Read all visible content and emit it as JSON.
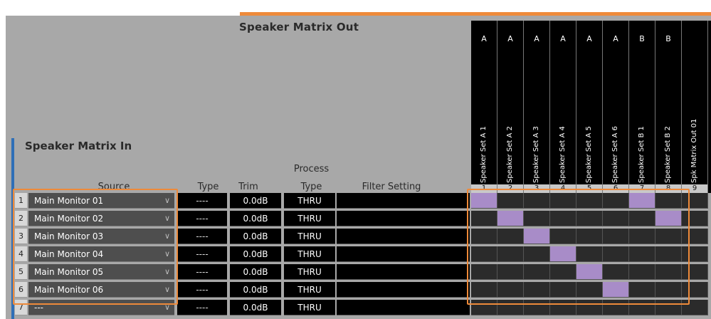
{
  "titles": {
    "matrix_out": "Speaker Matrix Out",
    "matrix_in": "Speaker Matrix In"
  },
  "headers": {
    "source": "Source",
    "type": "Type",
    "trim": "Trim",
    "process_line1": "Process",
    "process_line2": "Type",
    "filter": "Filter Setting"
  },
  "outputs": [
    {
      "group": "A",
      "name": "Speaker Set A 1",
      "num": "1"
    },
    {
      "group": "A",
      "name": "Speaker Set A 2",
      "num": "2"
    },
    {
      "group": "A",
      "name": "Speaker Set A 3",
      "num": "3"
    },
    {
      "group": "A",
      "name": "Speaker Set A 4",
      "num": "4"
    },
    {
      "group": "A",
      "name": "Speaker Set A 5",
      "num": "5"
    },
    {
      "group": "A",
      "name": "Speaker Set A 6",
      "num": "6"
    },
    {
      "group": "B",
      "name": "Speaker Set B 1",
      "num": "7"
    },
    {
      "group": "B",
      "name": "Speaker Set B 2",
      "num": "8"
    },
    {
      "group": "",
      "name": "Spk Matrix Out 01",
      "num": "9"
    }
  ],
  "rows": [
    {
      "num": "1",
      "source": "Main Monitor 01",
      "type": "----",
      "trim": "0.0dB",
      "process": "THRU",
      "routes": [
        1,
        7
      ]
    },
    {
      "num": "2",
      "source": "Main Monitor 02",
      "type": "----",
      "trim": "0.0dB",
      "process": "THRU",
      "routes": [
        2,
        8
      ]
    },
    {
      "num": "3",
      "source": "Main Monitor 03",
      "type": "----",
      "trim": "0.0dB",
      "process": "THRU",
      "routes": [
        3
      ]
    },
    {
      "num": "4",
      "source": "Main Monitor 04",
      "type": "----",
      "trim": "0.0dB",
      "process": "THRU",
      "routes": [
        4
      ]
    },
    {
      "num": "5",
      "source": "Main Monitor 05",
      "type": "----",
      "trim": "0.0dB",
      "process": "THRU",
      "routes": [
        5
      ]
    },
    {
      "num": "6",
      "source": "Main Monitor 06",
      "type": "----",
      "trim": "0.0dB",
      "process": "THRU",
      "routes": [
        6
      ]
    },
    {
      "num": "7",
      "source": "---",
      "type": "----",
      "trim": "0.0dB",
      "process": "THRU",
      "routes": []
    }
  ],
  "colors": {
    "accent_orange": "#ee8a3a",
    "accent_blue": "#2f6fb7",
    "route_on": "#a88cc8"
  },
  "icons": {
    "dropdown": "chevron-down-icon"
  }
}
